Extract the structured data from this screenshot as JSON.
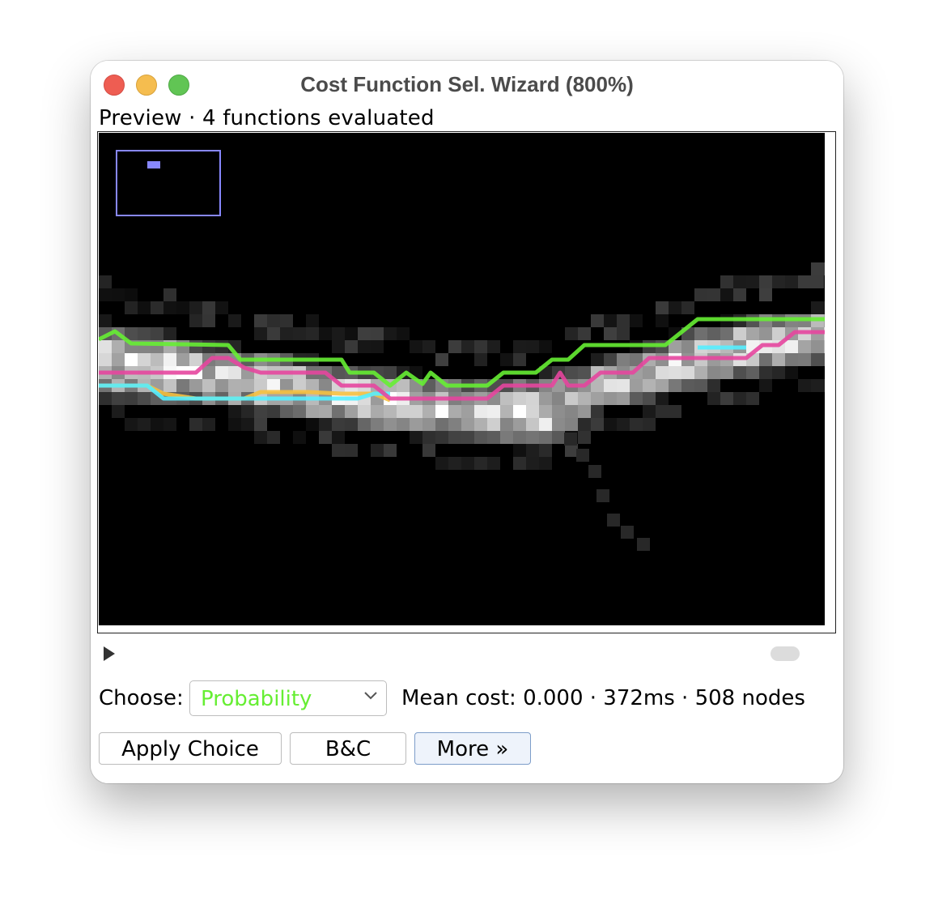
{
  "window": {
    "title": "Cost Function Sel. Wizard (800%)"
  },
  "preview": {
    "label": "Preview · 4 functions evaluated"
  },
  "controls": {
    "choose_label": "Choose:",
    "selected_function": "Probability",
    "status": "Mean cost: 0.000 · 372ms · 508 nodes"
  },
  "buttons": {
    "apply": "Apply Choice",
    "bc": "B&C",
    "more": "More »"
  },
  "colors": {
    "selected_text": "#66ee33",
    "path_green": "#66ee33",
    "path_magenta": "#e6469e",
    "path_cyan": "#55eeff",
    "path_yellow": "#f5c040",
    "overview_box": "#8888ff"
  }
}
